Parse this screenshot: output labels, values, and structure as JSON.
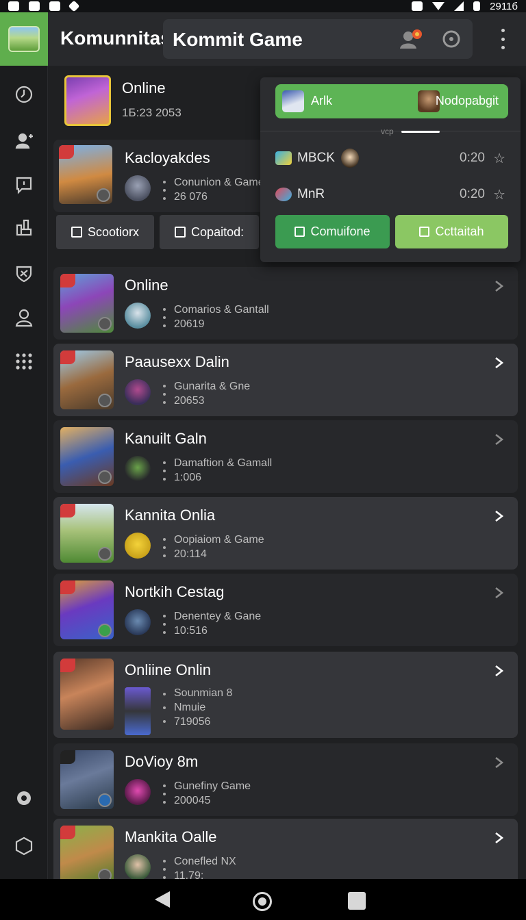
{
  "status_bar": {
    "time": "2911б"
  },
  "header": {
    "title": "Komunnitas",
    "search_value": "Kommit Game",
    "icons": [
      "user-alert-icon",
      "target-icon",
      "more-vert-icon"
    ]
  },
  "rail": {
    "items": [
      "compass-icon",
      "add-user-icon",
      "message-icon",
      "share-icon",
      "shield-icon",
      "profile-icon",
      "apps-icon",
      "settings-icon",
      "hexagon-icon"
    ]
  },
  "top_items": [
    {
      "title": "Online",
      "sub": "1Б:23 2053"
    },
    {
      "title": "Kacloyakdes",
      "line1": "Conunion & Game",
      "line2": "26 076"
    }
  ],
  "chips": [
    {
      "label": "Scootiorx"
    },
    {
      "label": "Copaitod:"
    }
  ],
  "popup": {
    "header_left": "Arlk",
    "header_right": "Nodopabgit",
    "tab_label": "vcp",
    "lines": [
      {
        "name": "MBCK",
        "time": "0:20",
        "star": "☆"
      },
      {
        "name": "MnR",
        "time": "0:20",
        "star": "☆"
      }
    ],
    "btn_left": "Comuifone",
    "btn_right": "Cсttaitah"
  },
  "rows": [
    {
      "title": "Online",
      "line1": "Comarios & Gantall",
      "line2": "20619"
    },
    {
      "title": "Paausexx Dalin",
      "line1": "Gunarita & Gne",
      "line2": "20653"
    },
    {
      "title": "Kanuilt Galn",
      "line1": "Damaftion & Gamall",
      "line2": "1:006"
    },
    {
      "title": "Kannita Onlia",
      "line1": "Oopiaiom & Game",
      "line2": "20:114"
    },
    {
      "title": "Nortkih Cestag",
      "line1": "Denentey & Gane",
      "line2": "10:516"
    },
    {
      "title": "Onliine Onlin",
      "line1": "Sounmian 8",
      "line2": "Nmuie",
      "line3": "719056"
    },
    {
      "title": "DoVioy 8m",
      "line1": "Gunefiny Game",
      "line2": "200045"
    },
    {
      "title": "Mankita Oalle",
      "line1": "Conefled NX",
      "line2": "11.79;"
    }
  ],
  "colors": {
    "accent_green": "#5db455",
    "light_green": "#8bc763",
    "bg": "#1f2022",
    "row": "#27282b",
    "row_alt": "#35363a"
  }
}
